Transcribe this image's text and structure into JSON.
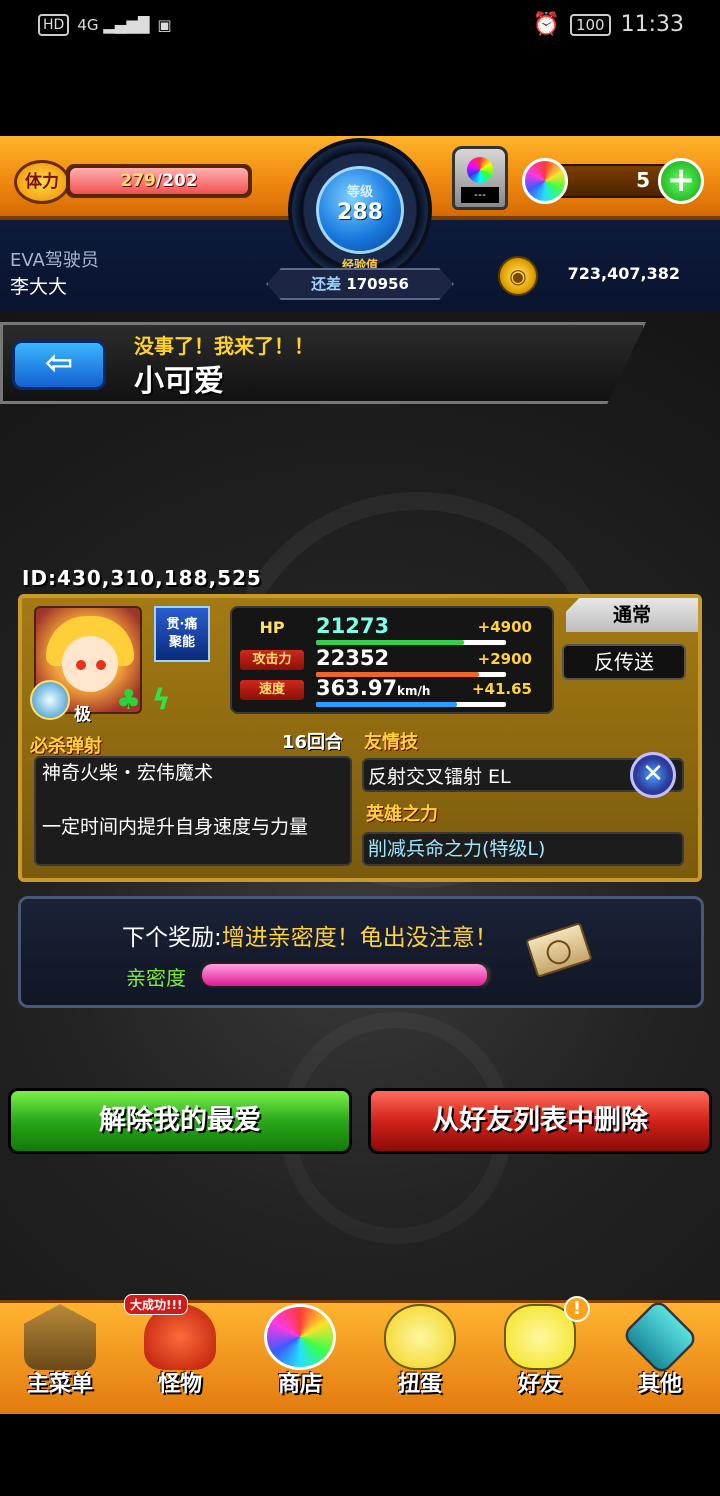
{
  "status_bar": {
    "left_icons": [
      "hd-icon",
      "signal-4g-icon",
      "vibrate-icon"
    ],
    "hd": "HD",
    "network": "4G",
    "battery": "100",
    "time": "11:33"
  },
  "hud": {
    "stamina_label": "体力",
    "stamina_current": "279",
    "stamina_max": "/202",
    "rank_label": "等级",
    "rank_value": "288",
    "exp_title": "经验值",
    "exp_label": "还差",
    "exp_value": "170956",
    "gauge_text": "---",
    "orb_count": "5",
    "plus": "+",
    "user_title": "EVA驾驶员",
    "user_name": "李大大",
    "coins": "723,407,382"
  },
  "header": {
    "back": "⇦",
    "subtitle": "没事了！我来了！！",
    "title": "小可爱"
  },
  "player_id": "ID:430,310,188,525",
  "monster": {
    "rarity": "极",
    "skill_badge_line1": "贯·痛",
    "skill_badge_line2": "聚能",
    "type": "通常",
    "counter": "反传送",
    "stats": [
      {
        "label": "HP",
        "value": "21273",
        "unit": "",
        "bonus": "+4900",
        "bar_color": "#33d14a",
        "bar_fraction": 0.78
      },
      {
        "label": "攻击力",
        "value": "22352",
        "unit": "",
        "bonus": "+2900",
        "bar_color": "#f0662a",
        "bar_fraction": 0.86
      },
      {
        "label": "速度",
        "value": "363.97",
        "unit": "km/h",
        "bonus": "+41.65",
        "bar_color": "#2a9cff",
        "bar_fraction": 0.74
      }
    ],
    "strike_shot_label": "必杀弹射",
    "strike_shot_name": "神奇火柴・宏伟魔术",
    "strike_shot_desc": "一定时间内提升自身速度与力量",
    "turns": "16回合",
    "friendship_label": "友情技",
    "friendship_name": "反射交叉镭射 EL",
    "hero_label": "英雄之力",
    "hero_name": "削减兵命之力(特级L)"
  },
  "reward": {
    "label": "下个奖励:",
    "value": "增进亲密度！龟出没注意！",
    "affinity_label": "亲密度",
    "affinity_fraction": 0.99
  },
  "actions": {
    "unfavorite": "解除我的最爱",
    "remove_friend": "从好友列表中删除"
  },
  "nav": {
    "items": [
      {
        "label": "主菜单",
        "icon": "gate-icon"
      },
      {
        "label": "怪物",
        "icon": "dragon-icon",
        "badge": "大成功!!!"
      },
      {
        "label": "商店",
        "icon": "rainbow-orb-icon"
      },
      {
        "label": "扭蛋",
        "icon": "egg-icon"
      },
      {
        "label": "好友",
        "icon": "friends-icon",
        "alert": "!"
      },
      {
        "label": "其他",
        "icon": "question-icon"
      }
    ]
  }
}
